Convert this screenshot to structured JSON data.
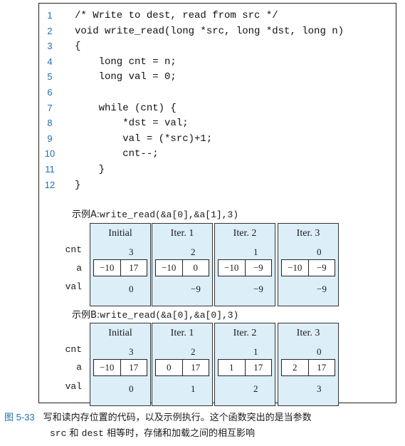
{
  "code": [
    {
      "n": "1",
      "text": "/* Write to dest, read from src */"
    },
    {
      "n": "2",
      "text": "void write_read(long *src, long *dst, long n)"
    },
    {
      "n": "3",
      "text": "{"
    },
    {
      "n": "4",
      "text": "    long cnt = n;"
    },
    {
      "n": "5",
      "text": "    long val = 0;"
    },
    {
      "n": "6",
      "text": ""
    },
    {
      "n": "7",
      "text": "    while (cnt) {"
    },
    {
      "n": "8",
      "text": "        *dst = val;"
    },
    {
      "n": "9",
      "text": "        val = (*src)+1;"
    },
    {
      "n": "10",
      "text": "        cnt--;"
    },
    {
      "n": "11",
      "text": "    }"
    },
    {
      "n": "12",
      "text": "}"
    }
  ],
  "row_labels": {
    "cnt": "cnt",
    "a": "a",
    "val": "val"
  },
  "examples": [
    {
      "label": "示例A:",
      "call": "write_read(&a[0],&a[1],3)",
      "panels": [
        {
          "title": "Initial",
          "cnt": "3",
          "a": [
            "−10",
            "17"
          ],
          "val": "0"
        },
        {
          "title": "Iter. 1",
          "cnt": "2",
          "a": [
            "−10",
            "0"
          ],
          "val": "−9"
        },
        {
          "title": "Iter. 2",
          "cnt": "1",
          "a": [
            "−10",
            "−9"
          ],
          "val": "−9"
        },
        {
          "title": "Iter. 3",
          "cnt": "0",
          "a": [
            "−10",
            "−9"
          ],
          "val": "−9"
        }
      ]
    },
    {
      "label": "示例B:",
      "call": "write_read(&a[0],&a[0],3)",
      "panels": [
        {
          "title": "Initial",
          "cnt": "3",
          "a": [
            "−10",
            "17"
          ],
          "val": "0"
        },
        {
          "title": "Iter. 1",
          "cnt": "2",
          "a": [
            "0",
            "17"
          ],
          "val": "1"
        },
        {
          "title": "Iter. 2",
          "cnt": "1",
          "a": [
            "1",
            "17"
          ],
          "val": "2"
        },
        {
          "title": "Iter. 3",
          "cnt": "0",
          "a": [
            "2",
            "17"
          ],
          "val": "3"
        }
      ]
    }
  ],
  "caption": {
    "number": "图 5-33",
    "line1_text": "写和读内存位置的代码，以及示例执行。这个函数突出的是当参数",
    "line2_src": "src",
    "line2_and": " 和 ",
    "line2_dest": "dest",
    "line2_rest": " 相等时，存储和加载之间的相互影响"
  },
  "colors": {
    "panel_bg": "#dceef8",
    "line_number": "#1f6fb5"
  }
}
